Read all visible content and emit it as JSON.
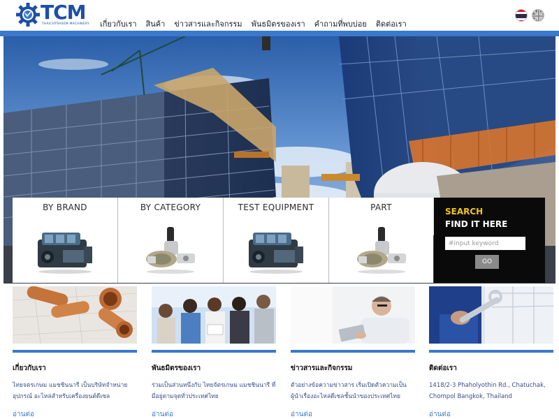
{
  "header": {
    "logo_text": "TCM",
    "logo_tagline": "THAICHTRASEM MACHINERY",
    "nav": [
      "เกี่ยวกับเรา",
      "สินค้า",
      "ข่าวสารและกิจกรรม",
      "พันธมิตรของเรา",
      "คำถามที่พบบ่อย",
      "ติดต่อเรา"
    ],
    "languages": [
      "th-flag-icon",
      "en-flag-icon"
    ]
  },
  "categories": [
    {
      "title": "BY BRAND",
      "icon": "engine-icon"
    },
    {
      "title": "BY CATEGORY",
      "icon": "pump-part-icon"
    },
    {
      "title": "TEST EQUIPMENT",
      "icon": "engine-icon"
    },
    {
      "title": "PART",
      "icon": "pump-part-icon"
    }
  ],
  "search": {
    "label_line1": "SEARCH",
    "label_line2": "FIND IT HERE",
    "placeholder": "#input keyword",
    "button": "GO"
  },
  "features": [
    {
      "title": "เกี่ยวกับเรา",
      "description": "ไทยจตรเกษม แมชชินนารี เป็นบริษัทจำหน่ายอุปกรณ์ อะไหล่สำหรับเครื่องยนต์ดีเซล",
      "more": "อ่านต่อ",
      "image": "copper-pipes-photo"
    },
    {
      "title": "พันธมิตรของเรา",
      "description": "ร่วมเป็นส่วนหนึ่งกับ ไทยจัตรเกษม แมชชินนารี ที่มีอยู่ตามจุดทั่วประเทศไทย",
      "more": "อ่านต่อ",
      "image": "business-team-photo"
    },
    {
      "title": "ข่าวสารและกิจกรรม",
      "description": "ตัวอย่างข้อความข่าวสาร เริ่มเปิดตัวความเป็นผู้นำเรื่องอะไหล่ดีเซลชั้นนำของประเทศไทย",
      "more": "อ่านต่อ",
      "image": "man-with-tablet-photo"
    },
    {
      "title": "ติดต่อเรา",
      "description": "1418/2-3 Phaholyothin Rd., Chatuchak, Chompol Bangkok, Thailand",
      "more": "อ่านต่อ",
      "image": "wrench-worker-photo"
    }
  ],
  "colors": {
    "brand_blue": "#1e4fa6",
    "rule_blue": "#3a79cc",
    "search_yellow": "#f3c418",
    "search_bg": "#0a0a0a"
  }
}
